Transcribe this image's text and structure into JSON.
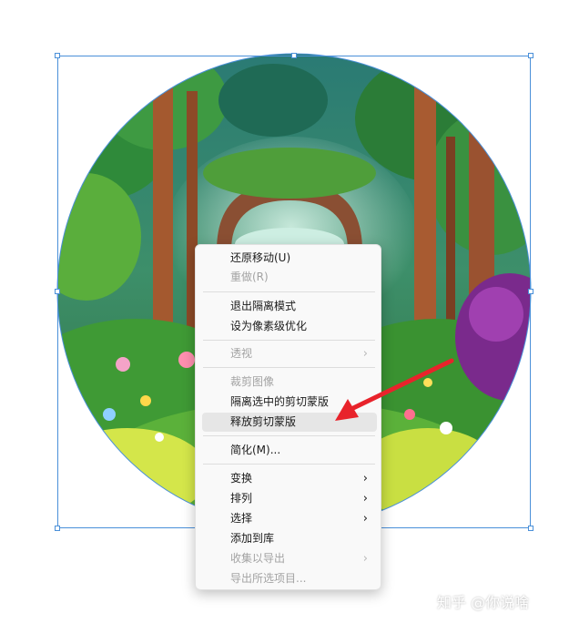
{
  "context_menu": {
    "items": [
      {
        "label": "还原移动(U)",
        "enabled": true
      },
      {
        "label": "重做(R)",
        "enabled": false
      },
      {
        "label": "退出隔离模式",
        "enabled": true
      },
      {
        "label": "设为像素级优化",
        "enabled": true
      },
      {
        "label": "透视",
        "enabled": false,
        "submenu": true
      },
      {
        "label": "裁剪图像",
        "enabled": false
      },
      {
        "label": "隔离选中的剪切蒙版",
        "enabled": true
      },
      {
        "label": "释放剪切蒙版",
        "enabled": true,
        "highlighted": true
      },
      {
        "label": "简化(M)...",
        "enabled": true
      },
      {
        "label": "变换",
        "enabled": true,
        "submenu": true
      },
      {
        "label": "排列",
        "enabled": true,
        "submenu": true
      },
      {
        "label": "选择",
        "enabled": true,
        "submenu": true
      },
      {
        "label": "添加到库",
        "enabled": true
      },
      {
        "label": "收集以导出",
        "enabled": false,
        "submenu": true
      },
      {
        "label": "导出所选项目...",
        "enabled": false
      }
    ],
    "submenu_arrow": "›"
  },
  "watermark": "知乎 @你说啥",
  "colors": {
    "selection": "#4a90d9",
    "annotation_arrow": "#e8232b",
    "highlight": "#e6e6e6"
  },
  "icons": [
    "submenu-arrow-icon",
    "red-pointer-arrow-icon"
  ]
}
